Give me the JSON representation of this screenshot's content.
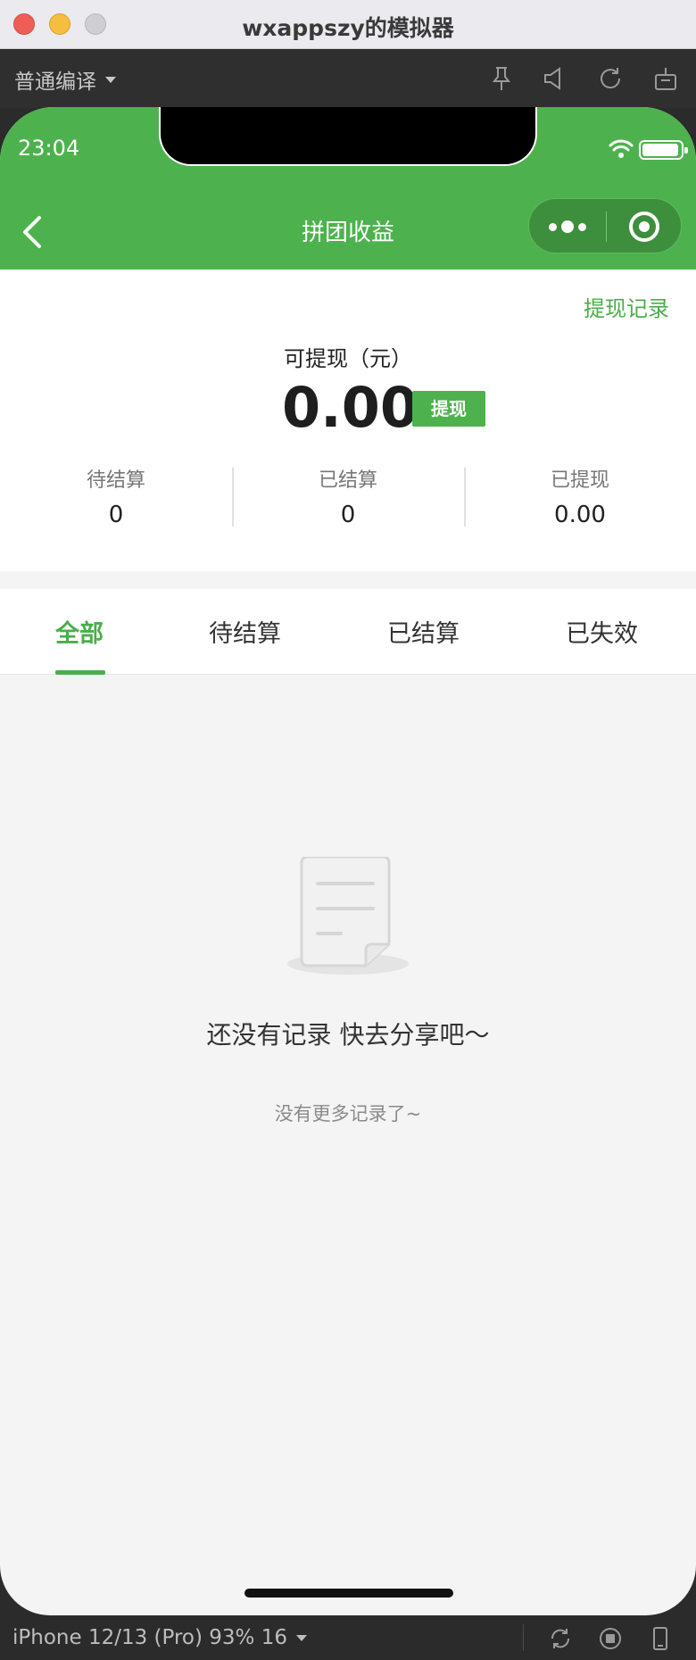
{
  "window": {
    "title": "wxappszy的模拟器"
  },
  "toolbar": {
    "compile_mode": "普通编译"
  },
  "status_bar": {
    "time": "23:04"
  },
  "nav": {
    "title": "拼团收益"
  },
  "summary": {
    "history_link": "提现记录",
    "available_label": "可提现（元）",
    "available_amount": "0.00",
    "withdraw_button": "提现",
    "stats": [
      {
        "label": "待结算",
        "value": "0"
      },
      {
        "label": "已结算",
        "value": "0"
      },
      {
        "label": "已提现",
        "value": "0.00"
      }
    ]
  },
  "tabs": [
    {
      "label": "全部",
      "active": true
    },
    {
      "label": "待结算",
      "active": false
    },
    {
      "label": "已结算",
      "active": false
    },
    {
      "label": "已失效",
      "active": false
    }
  ],
  "empty_state": {
    "message": "还没有记录 快去分享吧～",
    "no_more": "没有更多记录了~"
  },
  "bottom_bar": {
    "device": "iPhone 12/13 (Pro) 93% 16"
  },
  "colors": {
    "accent": "#4db24d",
    "background": "#f4f4f4"
  }
}
